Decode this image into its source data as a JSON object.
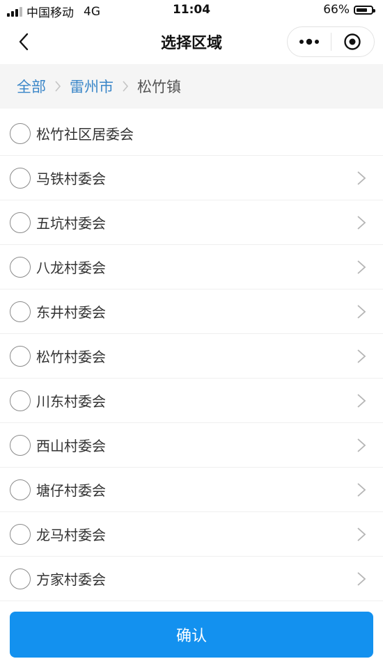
{
  "status_bar": {
    "carrier": "中国移动",
    "network": "4G",
    "time": "11:04",
    "battery_percent": "66%",
    "battery_level": 0.66
  },
  "navbar": {
    "title": "选择区域",
    "back_icon": "chevron-left-icon",
    "more_icon": "more-dots-icon",
    "close_icon": "target-circle-icon"
  },
  "breadcrumb": {
    "items": [
      "全部",
      "雷州市"
    ],
    "current": "松竹镇"
  },
  "list": {
    "items": [
      {
        "label": "松竹社区居委会",
        "has_children": false
      },
      {
        "label": "马铁村委会",
        "has_children": true
      },
      {
        "label": "五坑村委会",
        "has_children": true
      },
      {
        "label": "八龙村委会",
        "has_children": true
      },
      {
        "label": "东井村委会",
        "has_children": true
      },
      {
        "label": "松竹村委会",
        "has_children": true
      },
      {
        "label": "川东村委会",
        "has_children": true
      },
      {
        "label": "西山村委会",
        "has_children": true
      },
      {
        "label": "塘仔村委会",
        "has_children": true
      },
      {
        "label": "龙马村委会",
        "has_children": true
      },
      {
        "label": "方家村委会",
        "has_children": true
      }
    ]
  },
  "footer": {
    "confirm_label": "确认"
  },
  "colors": {
    "accent": "#1391ef",
    "link": "#3a86c8",
    "breadcrumb_bg": "#f5f5f5"
  }
}
